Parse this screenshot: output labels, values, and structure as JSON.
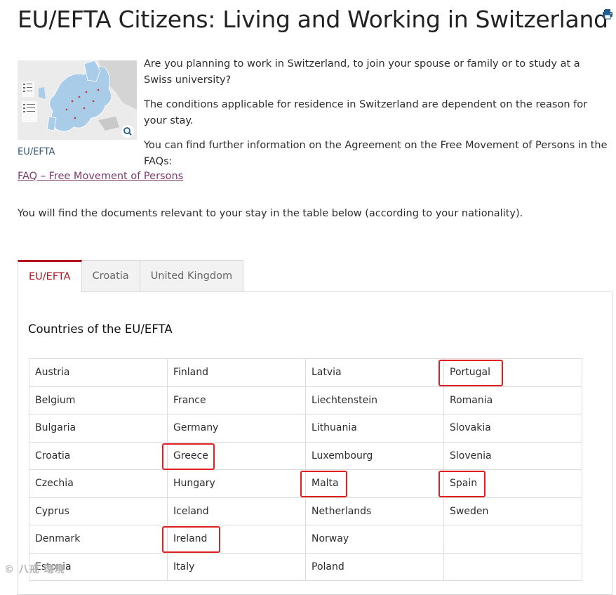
{
  "page": {
    "title": "EU/EFTA Citizens: Living and Working in Switzerland",
    "print_icon": "print-icon"
  },
  "map": {
    "caption": "EU/EFTA",
    "zoom_icon": "magnifier-icon"
  },
  "intro": {
    "paragraphs": [
      "Are you planning to work in Switzerland, to join your spouse or family or to study at a Swiss university?",
      "The conditions applicable for residence in Switzerland are dependent on the reason for your stay.",
      "You can find further information on the Agreement on the Free Movement of Persons in the FAQs:"
    ],
    "faq_link": "FAQ – Free Movement of Persons",
    "docs_note": "You will find the documents relevant to your stay in the table below (according to your nationality)."
  },
  "tabs": [
    {
      "label": "EU/EFTA",
      "active": true
    },
    {
      "label": "Croatia",
      "active": false
    },
    {
      "label": "United Kingdom",
      "active": false
    }
  ],
  "panel": {
    "title": "Countries of the EU/EFTA",
    "rows": [
      [
        "Austria",
        "Finland",
        "Latvia",
        "Portugal"
      ],
      [
        "Belgium",
        "France",
        "Liechtenstein",
        "Romania"
      ],
      [
        "Bulgaria",
        "Germany",
        "Lithuania",
        "Slovakia"
      ],
      [
        "Croatia",
        "Greece",
        "Luxembourg",
        "Slovenia"
      ],
      [
        "Czechia",
        "Hungary",
        "Malta",
        "Spain"
      ],
      [
        "Cyprus",
        "Iceland",
        "Netherlands",
        "Sweden"
      ],
      [
        "Denmark",
        "Ireland",
        "Norway",
        ""
      ],
      [
        "Estonia",
        "Italy",
        "Poland",
        ""
      ]
    ],
    "highlighted": [
      "Portugal",
      "Greece",
      "Malta",
      "Spain",
      "Ireland"
    ],
    "highlight_color": "#e02020"
  },
  "colors": {
    "accent": "#b3121f",
    "link": "#7a3a6c",
    "caption": "#33556e",
    "map_eu": "#a9cde8"
  },
  "watermark": "© 八戒 瑞境"
}
